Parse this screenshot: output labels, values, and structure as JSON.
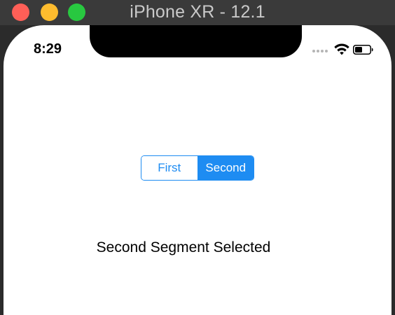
{
  "window": {
    "title": "iPhone XR - 12.1",
    "colors": {
      "close": "#ff5f57",
      "minimize": "#febc2e",
      "maximize": "#28c840",
      "titlebar": "#3a3a3a"
    }
  },
  "status_bar": {
    "time": "8:29",
    "icons": [
      "signal-dots-icon",
      "wifi-icon",
      "battery-icon"
    ]
  },
  "segmented_control": {
    "segments": [
      {
        "label": "First",
        "selected": false
      },
      {
        "label": "Second",
        "selected": true
      }
    ],
    "accent_color": "#1e8cf2"
  },
  "result": {
    "text": "Second Segment Selected"
  }
}
